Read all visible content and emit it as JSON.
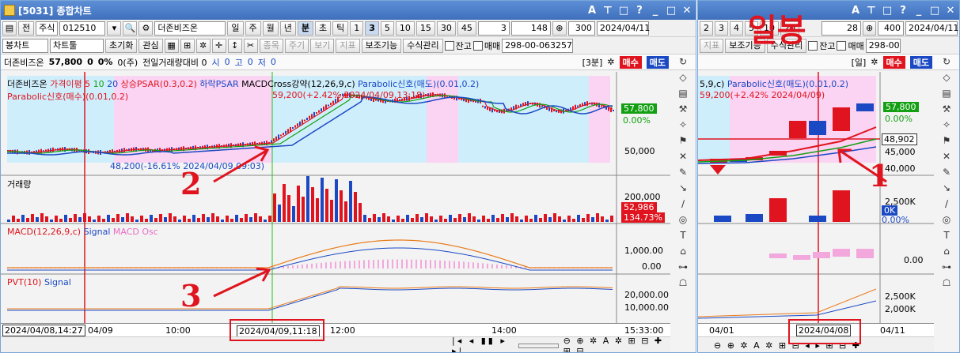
{
  "main": {
    "title": "[5031] 종합차트",
    "title_ctrls": [
      "A",
      "⊤",
      "□",
      "?",
      "_",
      "□",
      "✕"
    ],
    "toolbar1": {
      "jeon": "전",
      "stock_type": "주식",
      "code": "012510",
      "name": "더존비즈온",
      "periods": [
        "일",
        "주",
        "월",
        "년",
        "분",
        "초",
        "틱"
      ],
      "nums": [
        "1",
        "3",
        "5",
        "10",
        "15",
        "30",
        "45"
      ],
      "sel_num": "3",
      "count": "148",
      "count2": "300",
      "date": "2024/04/11"
    },
    "toolbar2": {
      "chart_type": "봉차트",
      "chart_tool": "차트툴",
      "init": "초기화",
      "interest": "관심",
      "items": [
        "종목",
        "주기",
        "보기",
        "지표"
      ],
      "aux": "보조기능",
      "formula": "수식관리",
      "balance": "잔고",
      "trade": "매매",
      "account": "298-00-063257"
    },
    "info": {
      "name": "더존비즈온",
      "price": "57,800",
      "change": "0",
      "pct": "0%",
      "vol": "0(주)",
      "compare": "전일거래량대비 0",
      "si_label": "시",
      "si": "0",
      "go_label": "고",
      "go": "0",
      "jeo_label": "저",
      "jeo": "0",
      "period": "[3분]",
      "buy": "매수",
      "sell": "매도"
    },
    "price_legend": {
      "title": "더존비즈온",
      "ma_label": "가격이평 5",
      "ma10": "10",
      "ma20": "20",
      "psar_up": "상승PSAR(0.3,0.2)",
      "psar_down": "하락PSAR",
      "macd_cross": "MACDCross강약(12,26,9,c)",
      "para_sell": "Parabolic신호(매도)(0.01,0.2)",
      "para_buy": "Parabolic신호(매수)(0.01,0.2)",
      "hi_note": "59,200(+2.42% 2024/04/09,13:18)",
      "lo_note": "48,200(-16.61% 2024/04/09,09:03)"
    },
    "price_scale": {
      "price_tag": "57,800",
      "pct_tag": "0.00%",
      "tick": "50,000"
    },
    "vol_pane": {
      "label": "거래량",
      "tick": "200,000",
      "tag": "52,986",
      "pct_tag": "134.73%"
    },
    "macd_pane": {
      "label": "MACD(12,26,9,c)",
      "signal": "Signal",
      "osc": "MACD Osc",
      "tick1": "1,000.00",
      "tick2": "0.00"
    },
    "pvt_pane": {
      "label": "PVT(10)",
      "signal": "Signal",
      "tick1": "20,000.00",
      "tick2": "10,000.00"
    },
    "time_axis": {
      "cursor": "2024/04/08,14:27",
      "t1": "04/09",
      "t2": "10:00",
      "t3": "2024/04/09,11:18",
      "t4": "12:00",
      "t5": "14:00",
      "clock": "15:33:00"
    }
  },
  "sub": {
    "title_ctrls": [
      "A",
      "⊤",
      "□",
      "?",
      "_",
      "□",
      "✕"
    ],
    "nums": [
      "2",
      "3",
      "4",
      "5",
      "10",
      "20"
    ],
    "count": "28",
    "count2": "400",
    "date": "2024/04/11",
    "items": [
      "지표"
    ],
    "aux": "보조기능",
    "formula": "수식관리",
    "balance": "잔고",
    "trade": "매매",
    "account": "298-00",
    "period": "[일]",
    "buy": "매수",
    "sell": "매도",
    "legend": "5,9,c)",
    "para_sell": "Parabolic신호(매도)(0.01,0.2)",
    "hi_note": "59,200(+2.42% 2024/04/09)",
    "price_tag": "57,800",
    "pct_tag": "0.00%",
    "cross_price": "48,902",
    "tick_45": "45,000",
    "tick_40": "40,000",
    "vol_tick": "2,500K",
    "vol_tag": "0K",
    "vol_pct": "0.00%",
    "macd_tick": "0.00",
    "pvt_tick1": "2,500K",
    "pvt_tick2": "2,000K",
    "date1": "04/01",
    "cursor_date": "2024/04/08",
    "date2": "04/11"
  },
  "annotations": {
    "a1": "1",
    "a2": "2",
    "a3": "3",
    "handwriting": "일봉"
  },
  "colors": {
    "up": "#e0141e",
    "down": "#1b49c4",
    "ma5": "#e0141e",
    "ma10": "#12a012",
    "ma20": "#1b49c4",
    "pink_bg": "#fbd3f3",
    "cyan_bg": "#cfeefc",
    "osc": "#f2a8dc",
    "signal": "#e87b19"
  }
}
